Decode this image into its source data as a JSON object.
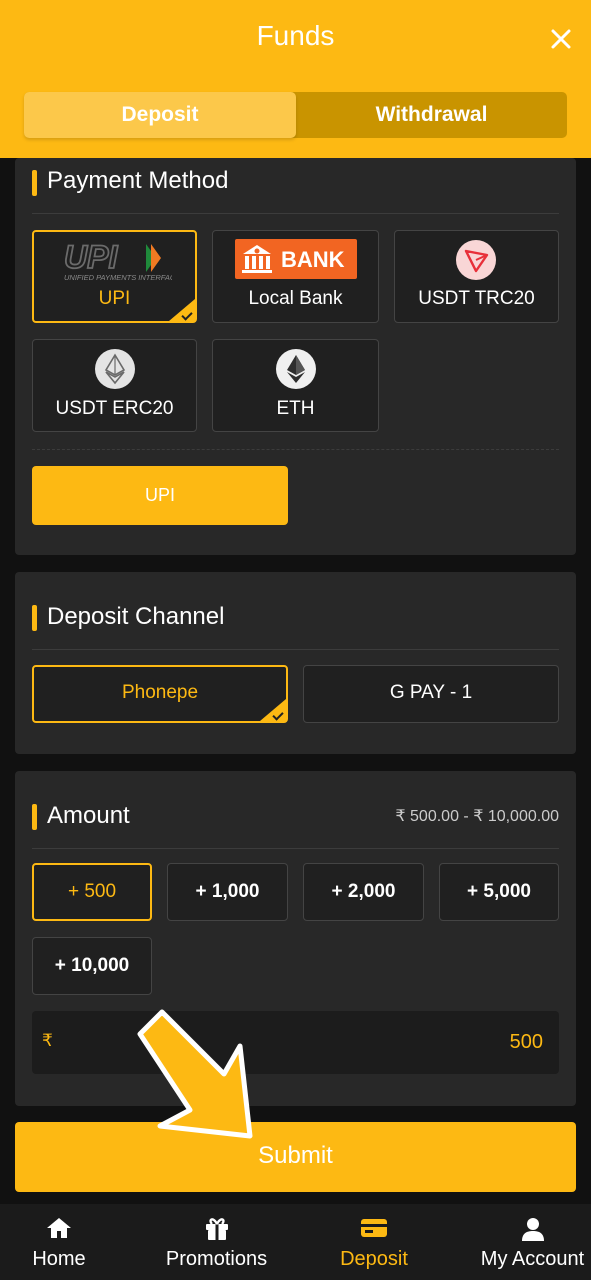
{
  "header": {
    "title": "Funds",
    "close_icon": "close-icon"
  },
  "tabs": [
    {
      "label": "Deposit",
      "active": true
    },
    {
      "label": "Withdrawal",
      "active": false
    }
  ],
  "payment_method": {
    "title": "Payment Method",
    "options": [
      {
        "label": "UPI",
        "icon": "upi-logo",
        "selected": true,
        "logo_text": "UPI",
        "logo_subtext": "UNIFIED PAYMENTS INTERFACE"
      },
      {
        "label": "Local Bank",
        "icon": "bank-logo",
        "selected": false,
        "logo_text": "BANK"
      },
      {
        "label": "USDT TRC20",
        "icon": "tron-icon",
        "selected": false
      },
      {
        "label": "USDT ERC20",
        "icon": "ethereum-icon",
        "selected": false
      },
      {
        "label": "ETH",
        "icon": "ethereum-icon",
        "selected": false
      }
    ],
    "sub_button": "UPI"
  },
  "deposit_channel": {
    "title": "Deposit Channel",
    "options": [
      {
        "label": "Phonepe",
        "selected": true
      },
      {
        "label": "G PAY - 1",
        "selected": false
      }
    ]
  },
  "amount": {
    "title": "Amount",
    "range": "₹ 500.00 - ₹ 10,000.00",
    "chips": [
      {
        "label": "+ 500",
        "selected": true
      },
      {
        "label": "+ 1,000",
        "selected": false
      },
      {
        "label": "+ 2,000",
        "selected": false
      },
      {
        "label": "+ 5,000",
        "selected": false
      },
      {
        "label": "+ 10,000",
        "selected": false
      }
    ],
    "currency_symbol": "₹",
    "value": "500"
  },
  "submit_label": "Submit",
  "nav": [
    {
      "label": "Home",
      "icon": "home-icon",
      "active": false
    },
    {
      "label": "Promotions",
      "icon": "gift-icon",
      "active": false
    },
    {
      "label": "Deposit",
      "icon": "card-icon",
      "active": true
    },
    {
      "label": "My Account",
      "icon": "user-icon",
      "active": false
    }
  ],
  "colors": {
    "accent": "#FDB913",
    "card": "#282828",
    "background": "#111111"
  }
}
